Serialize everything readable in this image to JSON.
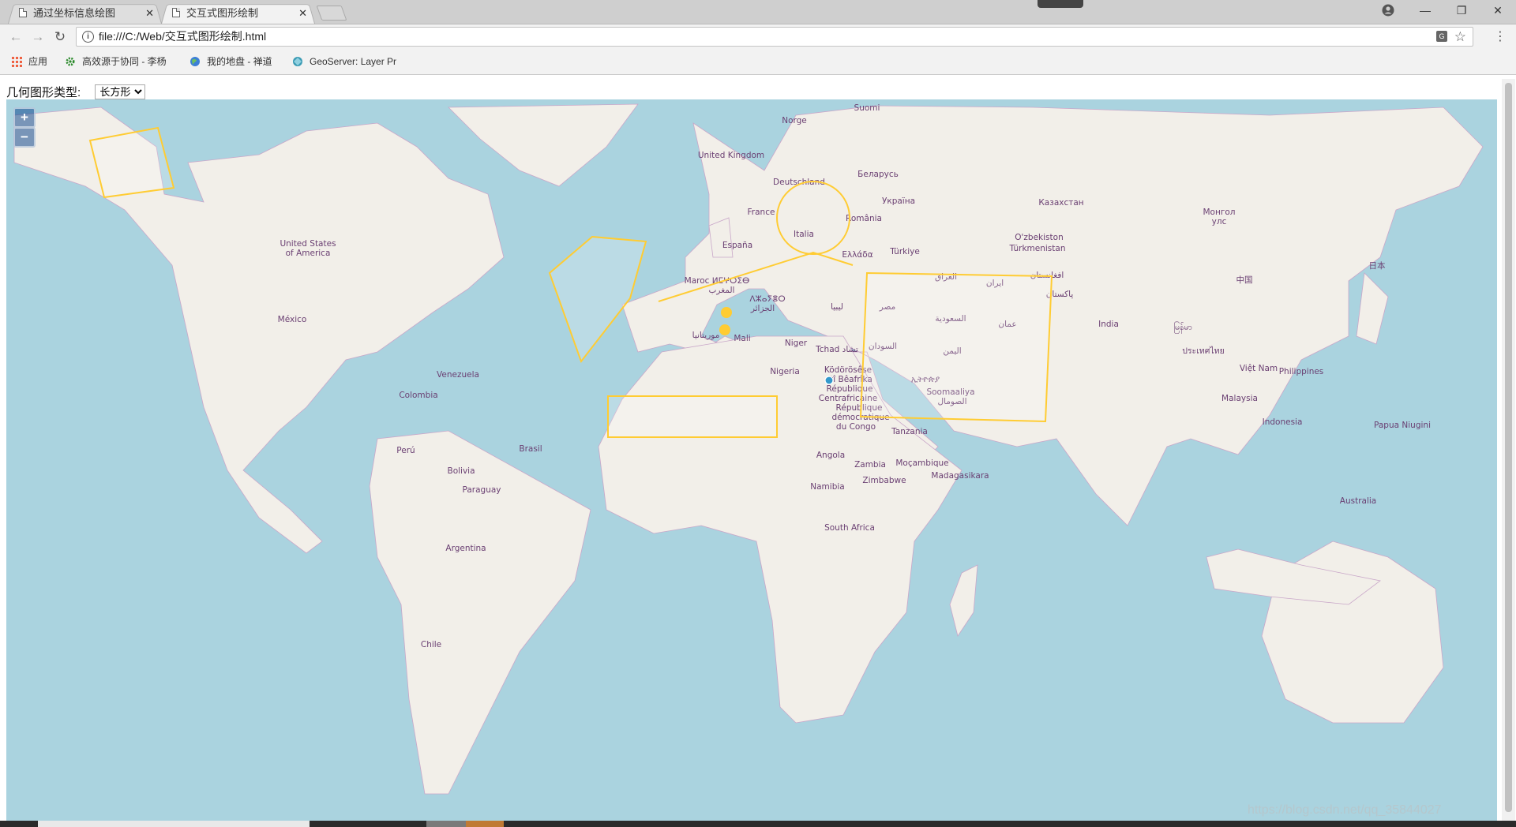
{
  "browser": {
    "tabs": [
      {
        "title": "通过坐标信息绘图",
        "active": false
      },
      {
        "title": "交互式图形绘制",
        "active": true
      }
    ],
    "address": "file:///C:/Web/交互式图形绘制.html",
    "bookmarks": [
      {
        "label": "应用",
        "icon": "apps-grid-icon"
      },
      {
        "label": "高效源于协同 - 李杨",
        "icon": "gear-green-icon"
      },
      {
        "label": "我的地盘 - 禅道",
        "icon": "globe-icon"
      },
      {
        "label": "GeoServer: Layer Pr",
        "icon": "geoserver-icon"
      }
    ]
  },
  "page": {
    "geometry_label": "几何图形类型:",
    "geometry_selected": "长方形",
    "zoom_in": "+",
    "zoom_out": "−"
  },
  "map": {
    "countries": [
      {
        "key": "suomi",
        "label": "Suomi"
      },
      {
        "key": "norge",
        "label": "Norge"
      },
      {
        "key": "uk",
        "label": "United Kingdom"
      },
      {
        "key": "belarus",
        "label": "Беларусь"
      },
      {
        "key": "deutschland",
        "label": "Deutschland"
      },
      {
        "key": "ukraina",
        "label": "Україна"
      },
      {
        "key": "kazakhstan",
        "label": "Казахстан"
      },
      {
        "key": "france",
        "label": "France"
      },
      {
        "key": "romania",
        "label": "România"
      },
      {
        "key": "mongol1",
        "label": "Монгол"
      },
      {
        "key": "mongol2",
        "label": "улс"
      },
      {
        "key": "italia",
        "label": "Italia"
      },
      {
        "key": "espana",
        "label": "España"
      },
      {
        "key": "uzbekiston",
        "label": "O'zbekiston"
      },
      {
        "key": "turkmenistan",
        "label": "Türkmenistan"
      },
      {
        "key": "usa1",
        "label": "United States"
      },
      {
        "key": "usa2",
        "label": "of America"
      },
      {
        "key": "turkiye",
        "label": "Türkiye"
      },
      {
        "key": "ellada",
        "label": "Ελλάδα"
      },
      {
        "key": "iraq",
        "label": "العراق"
      },
      {
        "key": "iran",
        "label": "ایران"
      },
      {
        "key": "afghanistan",
        "label": "افغانستان"
      },
      {
        "key": "nippon",
        "label": "日本"
      },
      {
        "key": "china",
        "label": "中国"
      },
      {
        "key": "maroc1",
        "label": "Maroc ⵍⵎⵖⵔⵉⴱ"
      },
      {
        "key": "maroc2",
        "label": "المغرب"
      },
      {
        "key": "pakistan",
        "label": "پاکستان"
      },
      {
        "key": "algerie1",
        "label": "ⴷⵣⴰⵢⴻⵔ"
      },
      {
        "key": "algerie2",
        "label": "الجزائر"
      },
      {
        "key": "libya",
        "label": "ليبيا"
      },
      {
        "key": "misr",
        "label": "مصر"
      },
      {
        "key": "saudi",
        "label": "السعودية"
      },
      {
        "key": "oman",
        "label": "عمان"
      },
      {
        "key": "mexico",
        "label": "México"
      },
      {
        "key": "india",
        "label": "India"
      },
      {
        "key": "myanmar",
        "label": "မြန်မာ"
      },
      {
        "key": "mauritania",
        "label": "موريتانيا"
      },
      {
        "key": "mali",
        "label": "Mali"
      },
      {
        "key": "niger",
        "label": "Niger"
      },
      {
        "key": "tchad",
        "label": "Tchad تشاد"
      },
      {
        "key": "sudan",
        "label": "السودان"
      },
      {
        "key": "yemen",
        "label": "اليمن"
      },
      {
        "key": "thailand",
        "label": "ประเทศไทย"
      },
      {
        "key": "venezuela",
        "label": "Venezuela"
      },
      {
        "key": "nigeria",
        "label": "Nigeria"
      },
      {
        "key": "car1",
        "label": "Ködörösêse"
      },
      {
        "key": "car2",
        "label": "tî Bêafrîka"
      },
      {
        "key": "car3",
        "label": "République"
      },
      {
        "key": "car4",
        "label": "Centrafricaine"
      },
      {
        "key": "ethiopia",
        "label": "ኢትዮጵያ"
      },
      {
        "key": "vietnam",
        "label": "Việt Nam"
      },
      {
        "key": "philippines",
        "label": "Philippines"
      },
      {
        "key": "colombia",
        "label": "Colombia"
      },
      {
        "key": "somalia1",
        "label": "Soomaaliya"
      },
      {
        "key": "somalia2",
        "label": "الصومال"
      },
      {
        "key": "malaysia",
        "label": "Malaysia"
      },
      {
        "key": "rdc1",
        "label": "République"
      },
      {
        "key": "rdc2",
        "label": "démocratique"
      },
      {
        "key": "rdc3",
        "label": "du Congo"
      },
      {
        "key": "indonesia",
        "label": "Indonesia"
      },
      {
        "key": "papua",
        "label": "Papua Niugini"
      },
      {
        "key": "tanzania",
        "label": "Tanzania"
      },
      {
        "key": "brasil",
        "label": "Brasil"
      },
      {
        "key": "peru",
        "label": "Perú"
      },
      {
        "key": "angola",
        "label": "Angola"
      },
      {
        "key": "zambia",
        "label": "Zambia"
      },
      {
        "key": "mocambique",
        "label": "Moçambique"
      },
      {
        "key": "bolivia",
        "label": "Bolivia"
      },
      {
        "key": "zimbabwe",
        "label": "Zimbabwe"
      },
      {
        "key": "madagasikara",
        "label": "Madagasikara"
      },
      {
        "key": "paraguay",
        "label": "Paraguay"
      },
      {
        "key": "namibia",
        "label": "Namibia"
      },
      {
        "key": "australia",
        "label": "Australia"
      },
      {
        "key": "southafrica",
        "label": "South Africa"
      },
      {
        "key": "argentina",
        "label": "Argentina"
      },
      {
        "key": "chile",
        "label": "Chile"
      }
    ],
    "drawn_features": [
      {
        "type": "Polygon",
        "name": "alaska-square"
      },
      {
        "type": "Polygon",
        "name": "atlantic-polygon"
      },
      {
        "type": "Circle",
        "name": "italy-circle"
      },
      {
        "type": "LineString",
        "name": "sahara-line"
      },
      {
        "type": "Point",
        "name": "mauritania-point-1"
      },
      {
        "type": "Point",
        "name": "mauritania-point-2"
      },
      {
        "type": "Box",
        "name": "atlantic-rectangle"
      },
      {
        "type": "Box",
        "name": "east-africa-box"
      },
      {
        "type": "Point",
        "name": "congo-cursor"
      }
    ],
    "colors": {
      "ocean": "#aad3df",
      "land": "#f2efe9",
      "border": "#c9a7c9",
      "stroke": "#ffcc33",
      "fill": "rgba(255,255,255,0.2)",
      "cursor": "#3399cc"
    }
  },
  "watermark": "https://blog.csdn.net/qq_35844027"
}
